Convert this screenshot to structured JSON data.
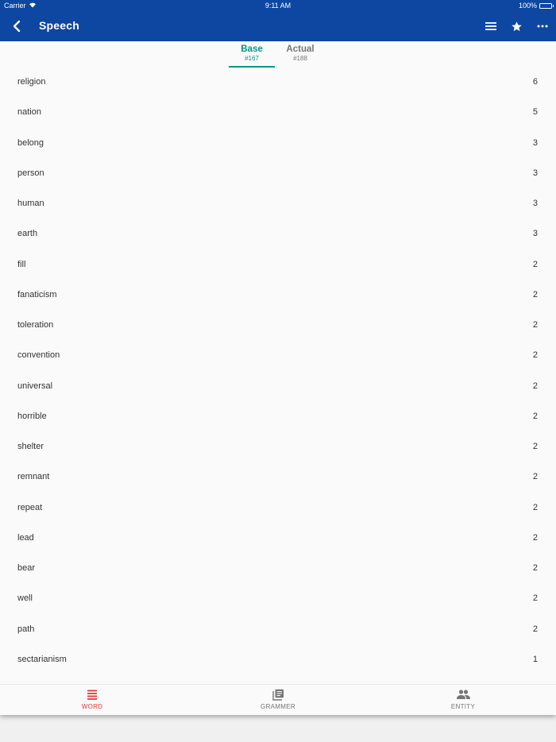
{
  "status_bar": {
    "carrier": "Carrier",
    "time": "9:11 AM",
    "battery": "100%"
  },
  "app_bar": {
    "title": "Speech"
  },
  "tabs": [
    {
      "label": "Base",
      "count": "#167",
      "active": true
    },
    {
      "label": "Actual",
      "count": "#188",
      "active": false
    }
  ],
  "words": [
    {
      "word": "religion",
      "count": "6"
    },
    {
      "word": "nation",
      "count": "5"
    },
    {
      "word": "belong",
      "count": "3"
    },
    {
      "word": "person",
      "count": "3"
    },
    {
      "word": "human",
      "count": "3"
    },
    {
      "word": "earth",
      "count": "3"
    },
    {
      "word": "fill",
      "count": "2"
    },
    {
      "word": "fanaticism",
      "count": "2"
    },
    {
      "word": "toleration",
      "count": "2"
    },
    {
      "word": "convention",
      "count": "2"
    },
    {
      "word": "universal",
      "count": "2"
    },
    {
      "word": "horrible",
      "count": "2"
    },
    {
      "word": "shelter",
      "count": "2"
    },
    {
      "word": "remnant",
      "count": "2"
    },
    {
      "word": "repeat",
      "count": "2"
    },
    {
      "word": "lead",
      "count": "2"
    },
    {
      "word": "bear",
      "count": "2"
    },
    {
      "word": "well",
      "count": "2"
    },
    {
      "word": "path",
      "count": "2"
    },
    {
      "word": "sectarianism",
      "count": "1"
    }
  ],
  "bottom_nav": [
    {
      "label": "WORD",
      "icon": "list-icon",
      "active": true
    },
    {
      "label": "GRAMMER",
      "icon": "library-books-icon",
      "active": false
    },
    {
      "label": "ENTITY",
      "icon": "people-icon",
      "active": false
    }
  ],
  "colors": {
    "app_bar": "#0d47a1",
    "tab_active": "#009688",
    "nav_active": "#e53935",
    "inactive": "#757575"
  }
}
